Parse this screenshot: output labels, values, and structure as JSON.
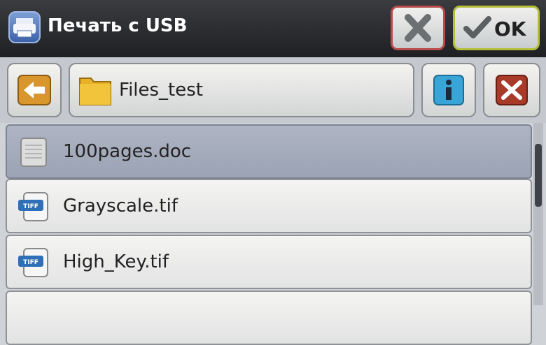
{
  "header": {
    "title": "Печать с USB",
    "ok_label": "OK"
  },
  "nav": {
    "path": "Files_test"
  },
  "files": [
    {
      "name": "100pages.doc",
      "icon": "document-icon",
      "selected": true
    },
    {
      "name": "Grayscale.tif",
      "icon": "tiff-icon",
      "selected": false
    },
    {
      "name": "High_Key.tif",
      "icon": "tiff-icon",
      "selected": false
    }
  ],
  "tiff_badge": "TIFF",
  "colors": {
    "accent_orange": "#d9962c",
    "info_blue": "#39a5d6",
    "cancel_red": "#a83a2a"
  }
}
